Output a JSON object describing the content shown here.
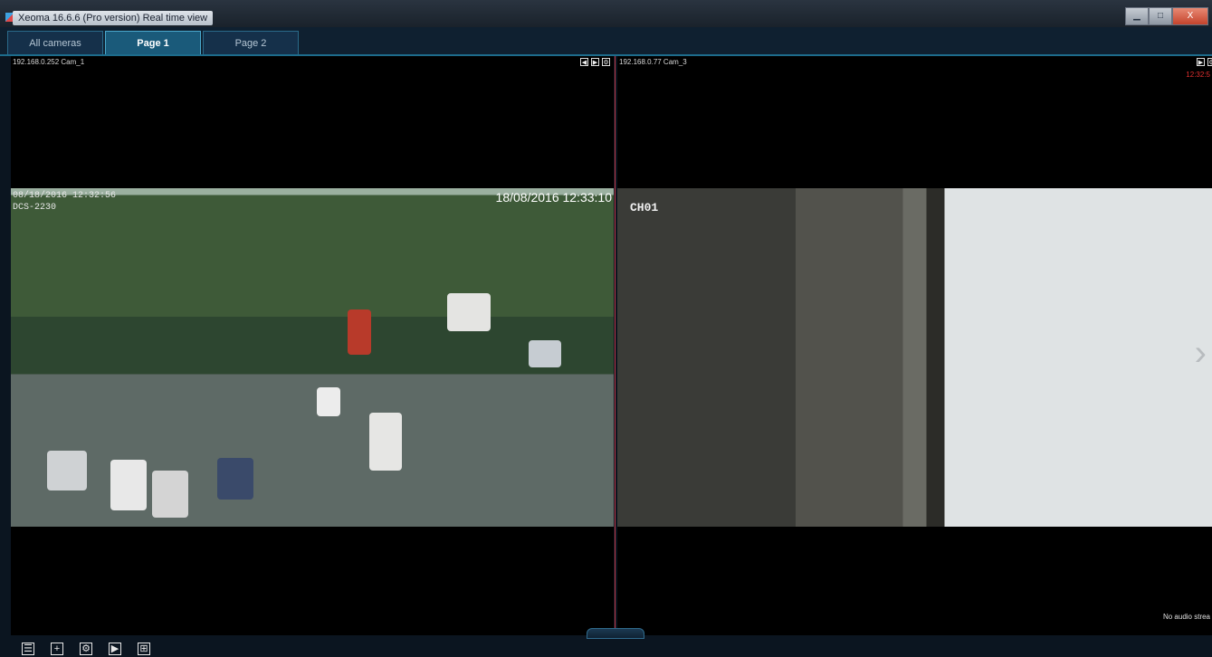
{
  "window": {
    "title": "Xeoma 16.6.6 (Pro version) Real time view",
    "controls": {
      "minimize": "▁",
      "maximize": "□",
      "close": "X"
    }
  },
  "tabs": [
    {
      "label": "All cameras",
      "active": false
    },
    {
      "label": "Page 1",
      "active": true
    },
    {
      "label": "Page 2",
      "active": false
    }
  ],
  "cameras": [
    {
      "label": "192.168.0.252 Cam_1",
      "osd_left_line1": "08/18/2016 12:32:56",
      "osd_left_line2": "DCS-2230",
      "osd_right": "18/08/2016 12:33:10"
    },
    {
      "label": "192.168.0.77 Cam_3",
      "rec_time": "12:32:5",
      "osd": "CH01",
      "audio_status": "No audio strea"
    }
  ],
  "toolbar_icons": [
    "list-icon",
    "add-icon",
    "settings-icon",
    "play-icon",
    "layout-icon"
  ],
  "colors": {
    "accent": "#1d6c8c",
    "divider": "#c0394a",
    "rec": "#e23030"
  }
}
